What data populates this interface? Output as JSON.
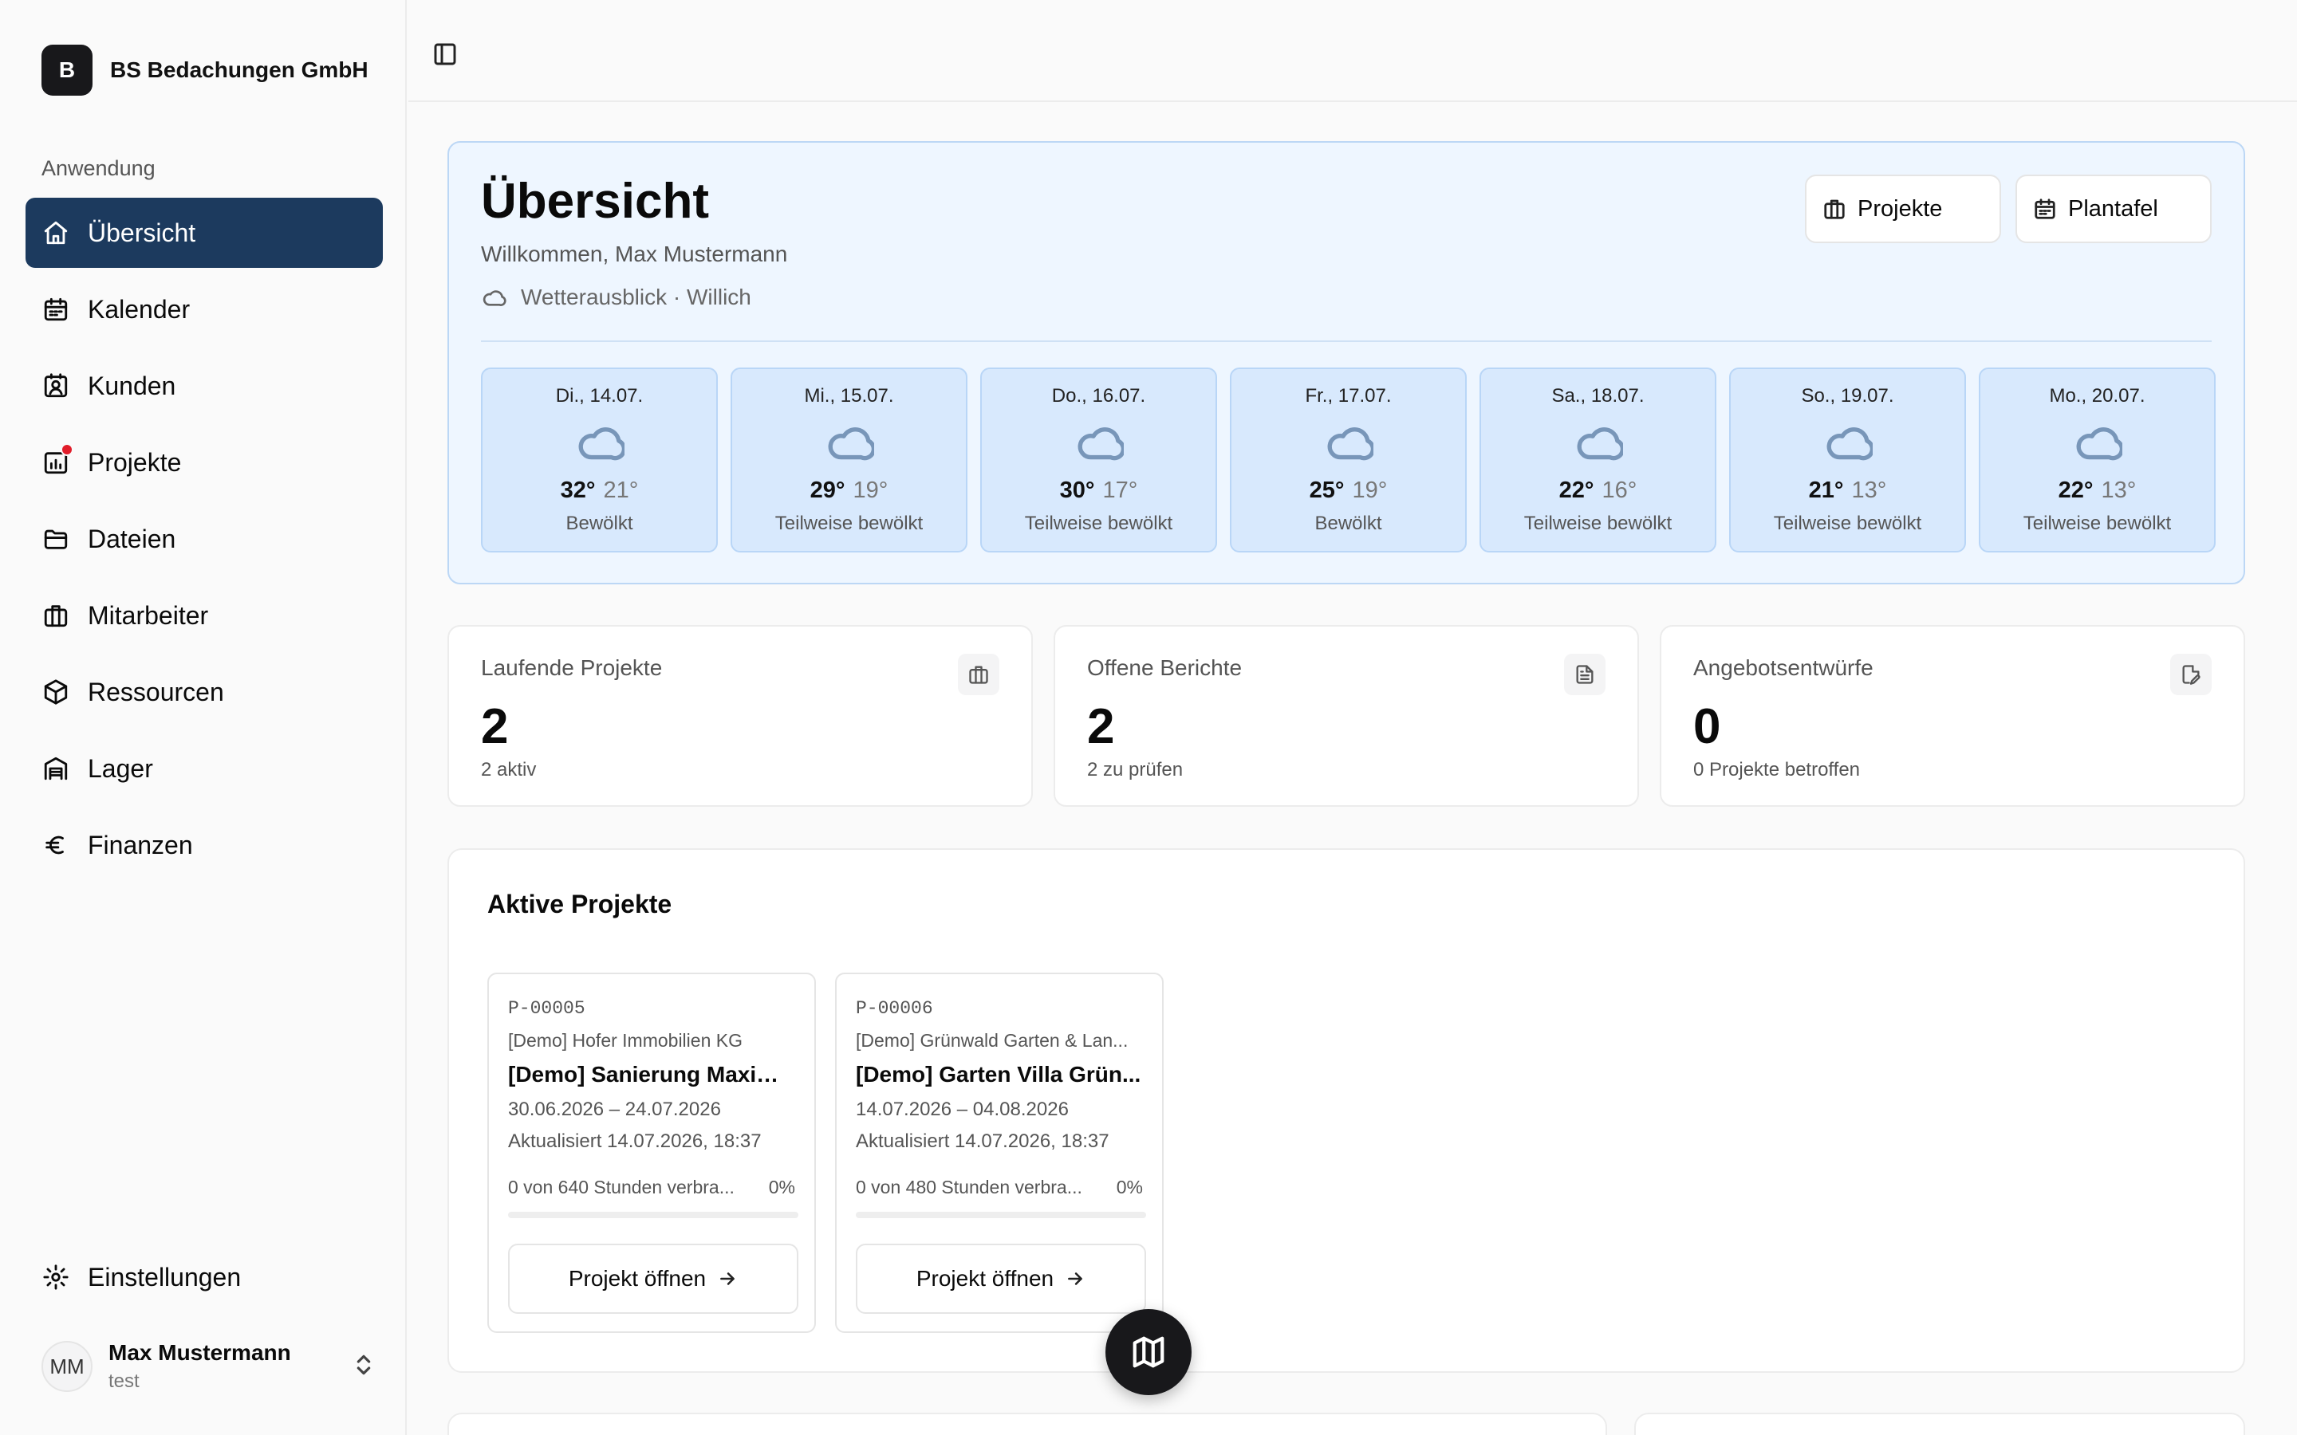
{
  "brand": {
    "logo_letter": "B",
    "name": "BS Bedachungen GmbH"
  },
  "sidebar": {
    "group_label": "Anwendung",
    "items": [
      {
        "label": "Übersicht",
        "icon": "home-icon",
        "active": true
      },
      {
        "label": "Kalender",
        "icon": "calendar-icon"
      },
      {
        "label": "Kunden",
        "icon": "contact-icon"
      },
      {
        "label": "Projekte",
        "icon": "chart-icon",
        "notification": true
      },
      {
        "label": "Dateien",
        "icon": "folder-icon"
      },
      {
        "label": "Mitarbeiter",
        "icon": "briefcase-icon"
      },
      {
        "label": "Ressourcen",
        "icon": "box-icon"
      },
      {
        "label": "Lager",
        "icon": "warehouse-icon"
      },
      {
        "label": "Finanzen",
        "icon": "euro-icon"
      }
    ],
    "settings_label": "Einstellungen",
    "user": {
      "initials": "MM",
      "name": "Max Mustermann",
      "role": "test"
    }
  },
  "colors": {
    "accent": "#1c3a5e",
    "hero_bg": "#eef6ff",
    "day_bg": "#d8e9fd",
    "notification": "#e11d2a"
  },
  "hero": {
    "title": "Übersicht",
    "subtitle": "Willkommen, Max Mustermann",
    "weather_label": "Wetterausblick · Willich",
    "actions": {
      "projects": "Projekte",
      "plan": "Plantafel"
    }
  },
  "forecast": [
    {
      "date": "Di., 14.07.",
      "high": "32°",
      "low": "21°",
      "condition": "Bewölkt"
    },
    {
      "date": "Mi., 15.07.",
      "high": "29°",
      "low": "19°",
      "condition": "Teilweise bewölkt"
    },
    {
      "date": "Do., 16.07.",
      "high": "30°",
      "low": "17°",
      "condition": "Teilweise bewölkt"
    },
    {
      "date": "Fr., 17.07.",
      "high": "25°",
      "low": "19°",
      "condition": "Bewölkt"
    },
    {
      "date": "Sa., 18.07.",
      "high": "22°",
      "low": "16°",
      "condition": "Teilweise bewölkt"
    },
    {
      "date": "So., 19.07.",
      "high": "21°",
      "low": "13°",
      "condition": "Teilweise bewölkt"
    },
    {
      "date": "Mo., 20.07.",
      "high": "22°",
      "low": "13°",
      "condition": "Teilweise bewölkt"
    }
  ],
  "stats": [
    {
      "label": "Laufende Projekte",
      "value": "2",
      "sub": "2 aktiv",
      "icon": "briefcase-icon"
    },
    {
      "label": "Offene Berichte",
      "value": "2",
      "sub": "2 zu prüfen",
      "icon": "document-icon"
    },
    {
      "label": "Angebotsentwürfe",
      "value": "0",
      "sub": "0 Projekte betroffen",
      "icon": "file-edit-icon"
    }
  ],
  "projects": {
    "title": "Aktive Projekte",
    "open_label": "Projekt öffnen",
    "items": [
      {
        "id": "P-00005",
        "client": "[Demo] Hofer Immobilien KG",
        "name": "[Demo] Sanierung Maximi...",
        "dates": "30.06.2026 – 24.07.2026",
        "updated": "Aktualisiert 14.07.2026, 18:37",
        "hours": "0 von 640 Stunden verbra...",
        "percent": "0%",
        "progress": 0
      },
      {
        "id": "P-00006",
        "client": "[Demo] Grünwald Garten & Lan...",
        "name": "[Demo] Garten Villa Grün...",
        "dates": "14.07.2026 – 04.08.2026",
        "updated": "Aktualisiert 14.07.2026, 18:37",
        "hours": "0 von 480 Stunden verbra...",
        "percent": "0%",
        "progress": 0
      }
    ]
  }
}
